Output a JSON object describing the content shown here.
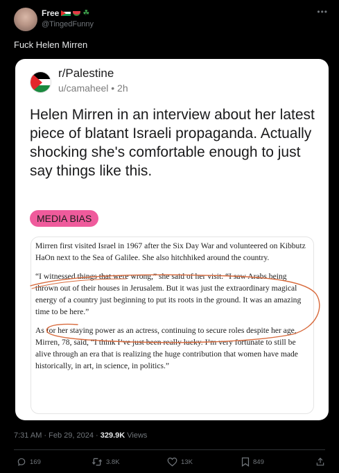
{
  "author": {
    "display_name": "Free",
    "handle": "@TingedFunny",
    "badges": [
      "palestine-flag",
      "watermelon",
      "herb"
    ]
  },
  "tweet": {
    "text": "Fuck Helen Mirren"
  },
  "reddit_post": {
    "subreddit": "r/Palestine",
    "meta": "u/camaheel • 2h",
    "title": "Helen Mirren in an interview about her latest piece of blatant Israeli propaganda. Actually shocking she's comfortable enough to just say things like this.",
    "flair": "MEDIA BIAS",
    "article_paragraphs": [
      "Mirren first visited Israel in 1967 after the Six Day War and volunteered on Kibbutz HaOn next to the Sea of Galilee. She also hitchhiked around the country.",
      "“I witnessed things that were wrong,” she said of her visit. “I saw Arabs being thrown out of their houses in Jerusalem. But it was just the extraordinary magical energy of a country just beginning to put its roots in the ground. It was an amazing time to be here.”",
      "As for her staying power as an actress, continuing to secure roles despite her age, Mirren, 78, said, “I think I’ve just been really lucky. I’m very fortunate to still be alive through an era that is realizing the huge contribution that women have made historically, in art, in science, in politics.”"
    ]
  },
  "meta": {
    "timestamp": "7:31 AM · Feb 29, 2024 · ",
    "views_count": "329.9K",
    "views_label": " Views"
  },
  "actions": {
    "replies": "169",
    "reposts": "3.8K",
    "likes": "13K",
    "bookmarks": "849"
  },
  "colors": {
    "background": "#000000",
    "text": "#e7e9ea",
    "muted": "#71767b",
    "flair": "#ef5b9c",
    "annotation": "#d86a3c"
  },
  "icons": [
    "more-icon",
    "reply-icon",
    "repost-icon",
    "like-icon",
    "bookmark-icon",
    "share-icon"
  ]
}
